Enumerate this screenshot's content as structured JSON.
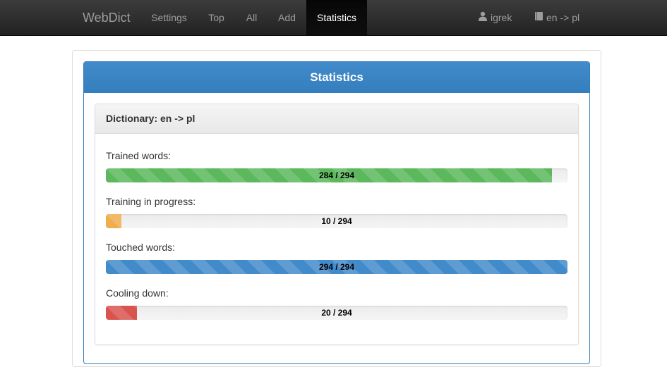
{
  "navbar": {
    "brand": "WebDict",
    "items": [
      {
        "label": "Settings"
      },
      {
        "label": "Top"
      },
      {
        "label": "All"
      },
      {
        "label": "Add"
      },
      {
        "label": "Statistics",
        "active": true
      }
    ],
    "user": "igrek",
    "dictionary": "en -> pl"
  },
  "panel": {
    "title": "Statistics",
    "dictionary_heading": "Dictionary: en -> pl"
  },
  "stats": [
    {
      "label": "Trained words:",
      "value": 284,
      "total": 294,
      "text": "284 / 294",
      "color": "#5cb85c"
    },
    {
      "label": "Training in progress:",
      "value": 10,
      "total": 294,
      "text": "10 / 294",
      "color": "#f0ad4e"
    },
    {
      "label": "Touched words:",
      "value": 294,
      "total": 294,
      "text": "294 / 294",
      "color": "#428bca"
    },
    {
      "label": "Cooling down:",
      "value": 20,
      "total": 294,
      "text": "20 / 294",
      "color": "#d9534f"
    }
  ],
  "colors": {
    "navbar_bg": "#222222",
    "primary": "#428bca",
    "success": "#5cb85c",
    "warning": "#f0ad4e",
    "danger": "#d9534f"
  },
  "icons": {
    "user": "user-icon",
    "dictionary": "book-icon"
  }
}
